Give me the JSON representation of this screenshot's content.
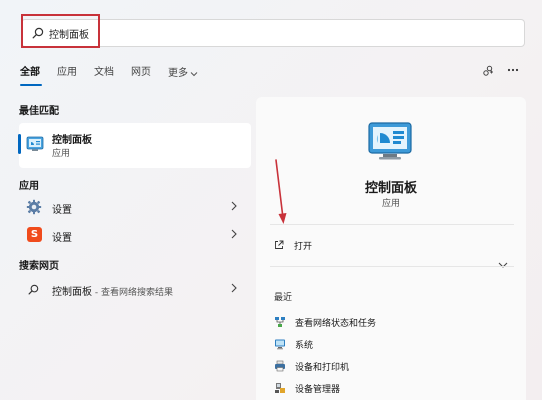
{
  "search": {
    "query": "控制面板"
  },
  "tabs": [
    {
      "label": "全部",
      "active": true
    },
    {
      "label": "应用",
      "active": false
    },
    {
      "label": "文档",
      "active": false
    },
    {
      "label": "网页",
      "active": false
    },
    {
      "label": "更多",
      "active": false
    }
  ],
  "left": {
    "best_match_title": "最佳匹配",
    "best_match": {
      "name": "控制面板",
      "type": "应用",
      "icon": "control-panel-icon"
    },
    "apps_title": "应用",
    "apps": [
      {
        "label": "设置",
        "icon": "gear-icon"
      },
      {
        "label": "设置",
        "icon": "sogou-icon",
        "glyph": "S"
      }
    ],
    "web_title": "搜索网页",
    "web": {
      "query": "控制面板",
      "separator": " - ",
      "hint": "查看网络搜索结果"
    }
  },
  "right": {
    "title": "控制面板",
    "subtitle": "应用",
    "open_label": "打开",
    "recent_title": "最近",
    "recent": [
      {
        "label": "查看网络状态和任务",
        "icon": "network-icon"
      },
      {
        "label": "系统",
        "icon": "system-icon"
      },
      {
        "label": "设备和打印机",
        "icon": "printer-icon"
      },
      {
        "label": "设备管理器",
        "icon": "device-manager-icon"
      }
    ]
  },
  "colors": {
    "accent": "#0067c0",
    "highlight": "#c8323a",
    "sogou": "#f04b1c"
  }
}
